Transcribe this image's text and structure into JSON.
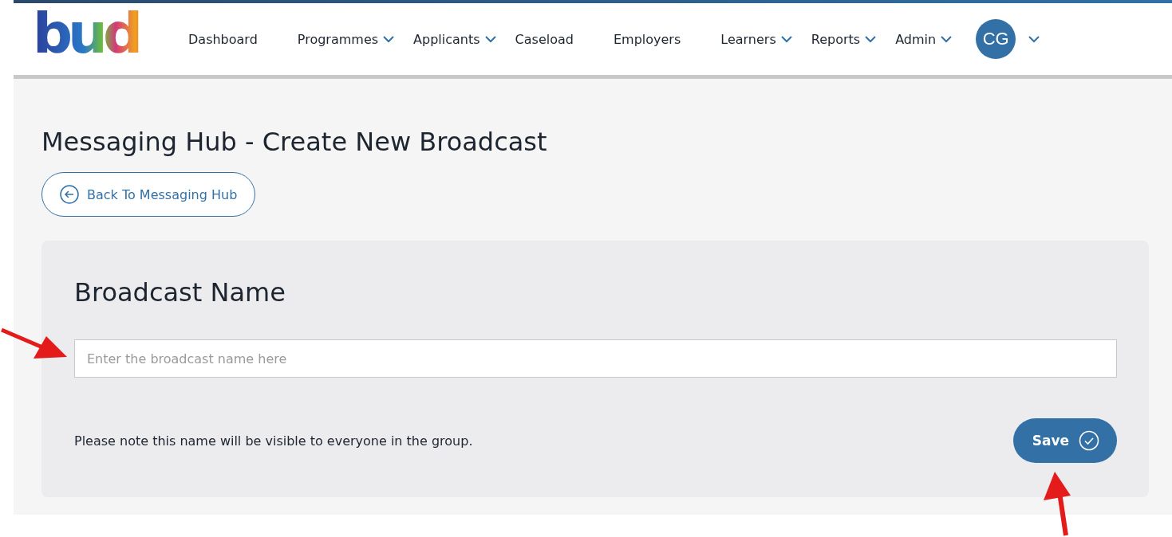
{
  "logo": {
    "text": "bud"
  },
  "nav": [
    {
      "label": "Dashboard",
      "has_menu": false
    },
    {
      "label": "Programmes",
      "has_menu": true
    },
    {
      "label": "Applicants",
      "has_menu": true
    },
    {
      "label": "Caseload",
      "has_menu": false
    },
    {
      "label": "Employers",
      "has_menu": false
    },
    {
      "label": "Learners",
      "has_menu": true
    },
    {
      "label": "Reports",
      "has_menu": true
    },
    {
      "label": "Admin",
      "has_menu": true
    }
  ],
  "user": {
    "initials": "CG"
  },
  "page": {
    "title": "Messaging Hub - Create New Broadcast",
    "back_button": "Back To Messaging Hub"
  },
  "form": {
    "heading": "Broadcast Name",
    "placeholder": "Enter the broadcast name here",
    "note": "Please note this name will be visible to everyone in the group.",
    "save_button": "Save"
  }
}
